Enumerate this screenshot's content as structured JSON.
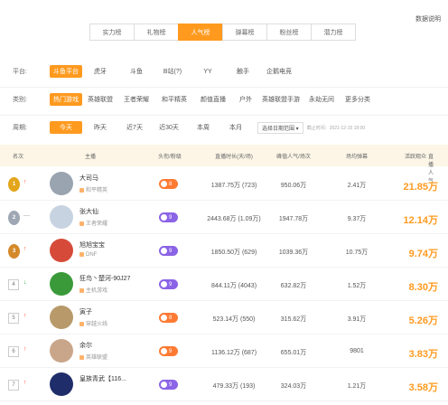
{
  "top_note": "数据说明",
  "tabs": [
    {
      "label": "实力榜"
    },
    {
      "label": "礼物榜"
    },
    {
      "label": "人气榜"
    },
    {
      "label": "弹幕榜"
    },
    {
      "label": "粉丝榜",
      "badge": "NEW"
    },
    {
      "label": "潜力榜"
    }
  ],
  "filters": {
    "platform": {
      "label": "平台:",
      "options": [
        "斗鱼平台",
        "虎牙",
        "斗鱼",
        "B站(?)",
        "YY",
        "触手",
        "企鹅电竞"
      ]
    },
    "category": {
      "label": "类别:",
      "options": [
        "热门游戏",
        "英雄联盟",
        "王者荣耀",
        "和平精英",
        "颜值直播",
        "户外",
        "英雄联盟手游",
        "永劫无间",
        "更多分类"
      ]
    },
    "time": {
      "label": "周期:",
      "options": [
        "今天",
        "昨天",
        "近7天",
        "近30天",
        "本周",
        "本月"
      ],
      "date_select": "选择日期范围 ▾",
      "hint": "截止时间：2021-12-15 18:00"
    }
  },
  "table": {
    "headers": [
      "名次",
      "主播",
      "头衔/粉级",
      "直播时长(天/场)",
      "峰值人气/场次",
      "场均弹幕",
      "活跃观众",
      "直播人气"
    ],
    "rows": [
      {
        "rank": "1",
        "medal": "gold",
        "trend": "↑",
        "name": "大司马",
        "category": "和平精英",
        "level": "8",
        "level_color": "orange",
        "duration": "1387.75万 (723)",
        "peak": "950.06万",
        "danmu": "2.41万",
        "popularity": "21.85万",
        "avatar_bg": "#9aa4b0"
      },
      {
        "rank": "2",
        "medal": "silver",
        "trend": "—",
        "name": "张大仙",
        "category": "王者荣耀",
        "level": "9",
        "level_color": "purple",
        "duration": "2443.68万 (1.09万)",
        "peak": "1947.78万",
        "danmu": "9.37万",
        "popularity": "12.14万",
        "avatar_bg": "#c7d3e0"
      },
      {
        "rank": "3",
        "medal": "bronze",
        "trend": "↑",
        "name": "旭旭宝宝",
        "category": "DNF",
        "level": "9",
        "level_color": "purple",
        "duration": "1850.50万 (629)",
        "peak": "1039.36万",
        "danmu": "10.75万",
        "popularity": "9.74万",
        "avatar_bg": "#d64a3a"
      },
      {
        "rank": "4",
        "medal": "",
        "trend": "↓",
        "name": "狂鸟丶楚河-90J27",
        "category": "主机游戏",
        "level": "9",
        "level_color": "purple",
        "duration": "844.11万 (4043)",
        "peak": "632.82万",
        "danmu": "1.52万",
        "popularity": "8.30万",
        "avatar_bg": "#3a9a3a"
      },
      {
        "rank": "5",
        "medal": "",
        "trend": "↑",
        "name": "寅子",
        "category": "穿越火线",
        "level": "8",
        "level_color": "orange",
        "duration": "523.14万 (550)",
        "peak": "315.62万",
        "danmu": "3.91万",
        "popularity": "5.26万",
        "avatar_bg": "#b89a6a"
      },
      {
        "rank": "6",
        "medal": "",
        "trend": "↑",
        "name": "余尔",
        "category": "英雄联盟",
        "level": "9",
        "level_color": "orange",
        "duration": "1136.12万 (687)",
        "peak": "655.01万",
        "danmu": "9801",
        "popularity": "3.83万",
        "avatar_bg": "#c9a68a"
      },
      {
        "rank": "7",
        "medal": "",
        "trend": "↑",
        "name": "皇族青武【116...",
        "category": "",
        "level": "9",
        "level_color": "purple",
        "duration": "479.33万 (193)",
        "peak": "324.03万",
        "danmu": "1.21万",
        "popularity": "3.58万",
        "avatar_bg": "#1f2d6a"
      }
    ]
  }
}
